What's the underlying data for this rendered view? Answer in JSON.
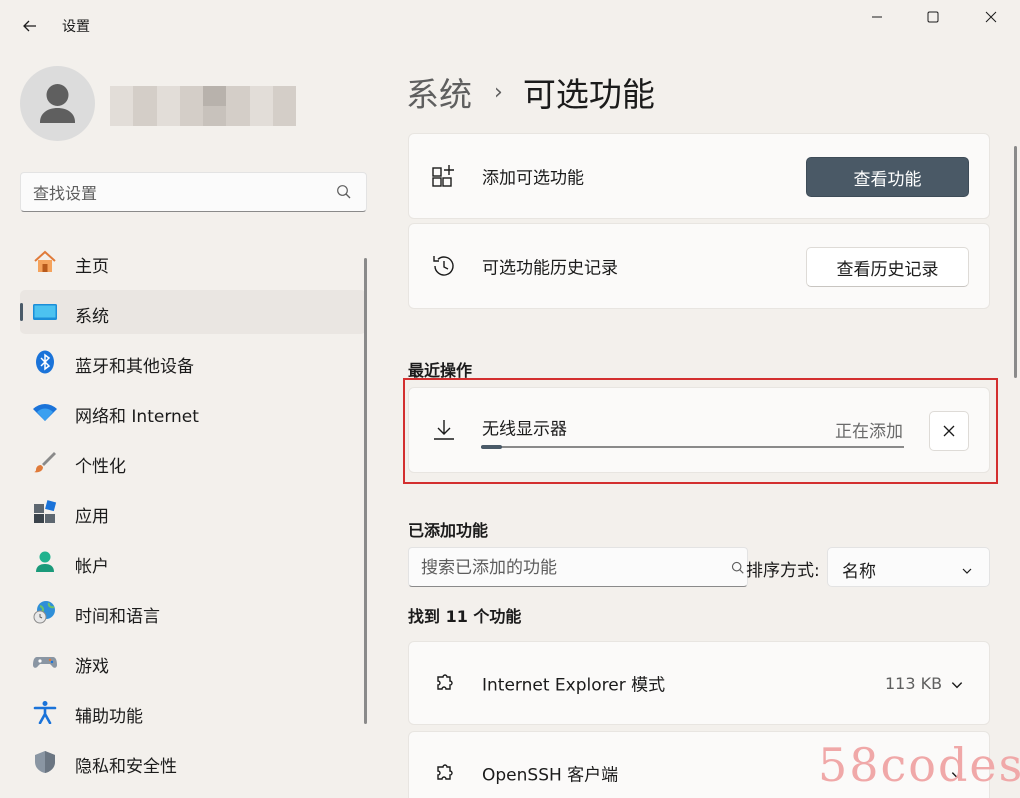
{
  "app": {
    "title": "设置"
  },
  "sidebar": {
    "search_placeholder": "查找设置",
    "items": [
      {
        "label": "主页",
        "icon": "home-icon"
      },
      {
        "label": "系统",
        "icon": "system-icon",
        "active": true
      },
      {
        "label": "蓝牙和其他设备",
        "icon": "bluetooth-icon"
      },
      {
        "label": "网络和 Internet",
        "icon": "wifi-icon"
      },
      {
        "label": "个性化",
        "icon": "brush-icon"
      },
      {
        "label": "应用",
        "icon": "apps-icon"
      },
      {
        "label": "帐户",
        "icon": "account-icon"
      },
      {
        "label": "时间和语言",
        "icon": "globe-clock-icon"
      },
      {
        "label": "游戏",
        "icon": "gamepad-icon"
      },
      {
        "label": "辅助功能",
        "icon": "accessibility-icon"
      },
      {
        "label": "隐私和安全性",
        "icon": "shield-icon"
      }
    ]
  },
  "breadcrumb": {
    "parent": "系统",
    "separator": "›",
    "current": "可选功能"
  },
  "cards": {
    "add_feature": {
      "label": "添加可选功能",
      "button": "查看功能"
    },
    "history": {
      "label": "可选功能历史记录",
      "button": "查看历史记录"
    }
  },
  "recent": {
    "title": "最近操作",
    "item": {
      "name": "无线显示器",
      "status": "正在添加",
      "progress": 0.05
    }
  },
  "added": {
    "title": "已添加功能",
    "search_placeholder": "搜索已添加的功能",
    "sort_label": "排序方式:",
    "sort_value": "名称",
    "found": "找到 11 个功能",
    "features": [
      {
        "name": "Internet Explorer 模式",
        "size": "113 KB"
      },
      {
        "name": "OpenSSH 客户端",
        "size": ""
      }
    ]
  },
  "watermark": "58codes",
  "colors": {
    "accent": "#4a5966",
    "highlight": "#d32f2f",
    "background": "#f3f0ec"
  }
}
